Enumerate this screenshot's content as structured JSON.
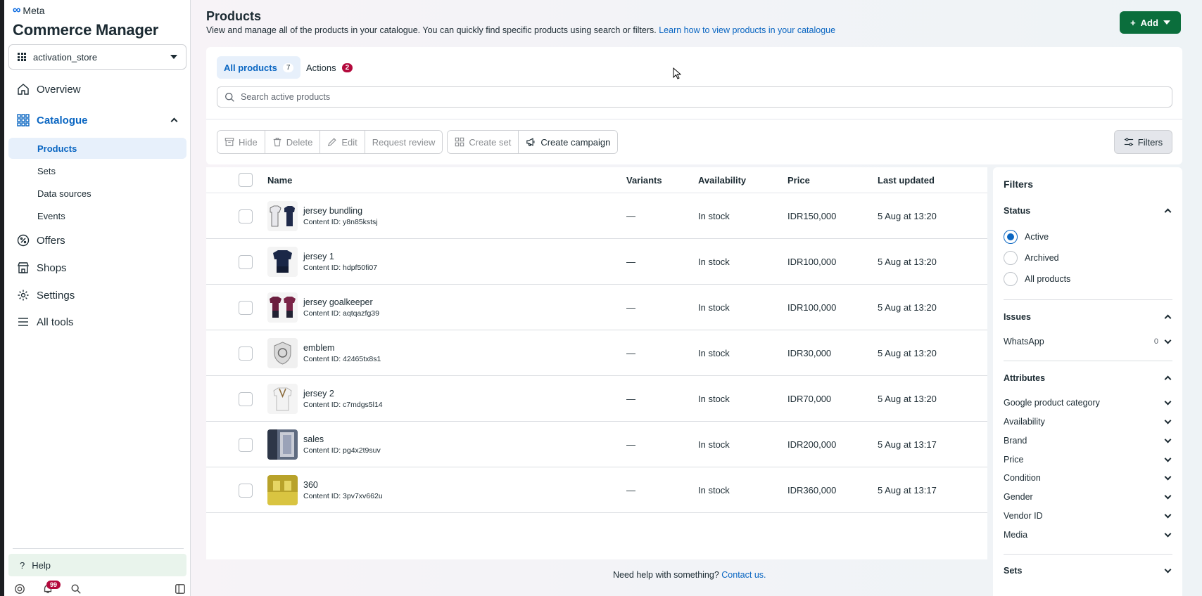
{
  "brand": {
    "meta_label": "Meta",
    "app_title": "Commerce Manager"
  },
  "store_select": {
    "value": "activation_store"
  },
  "sidebar": {
    "items": [
      {
        "label": "Overview",
        "icon": "home-icon"
      },
      {
        "label": "Catalogue",
        "icon": "grid-icon"
      },
      {
        "label": "Offers",
        "icon": "offers-icon"
      },
      {
        "label": "Shops",
        "icon": "shop-icon"
      },
      {
        "label": "Settings",
        "icon": "gear-icon"
      },
      {
        "label": "All tools",
        "icon": "menu-icon"
      }
    ],
    "catalogue_sub": [
      "Products",
      "Sets",
      "Data sources",
      "Events"
    ],
    "help_label": "Help",
    "notifications_count": "99"
  },
  "header": {
    "title": "Products",
    "description": "View and manage all of the products in your catalogue. You can quickly find specific products using search or filters.",
    "learn_link": "Learn how to view products in your catalogue",
    "add_label": "Add"
  },
  "tabs": {
    "all_label": "All products",
    "all_count": "7",
    "actions_label": "Actions",
    "actions_count": "2"
  },
  "search": {
    "placeholder": "Search active products"
  },
  "toolbar": {
    "hide": "Hide",
    "delete": "Delete",
    "edit": "Edit",
    "request_review": "Request review",
    "create_set": "Create set",
    "create_campaign": "Create campaign",
    "filters": "Filters"
  },
  "table": {
    "columns": [
      "Name",
      "Variants",
      "Availability",
      "Price",
      "Last updated"
    ],
    "rows": [
      {
        "name": "jersey bundling",
        "content_id": "Content ID: y8n85kstsj",
        "variants": "—",
        "availability": "In stock",
        "price": "IDR150,000",
        "updated": "5 Aug at 13:20"
      },
      {
        "name": "jersey 1",
        "content_id": "Content ID: hdpf50fi07",
        "variants": "—",
        "availability": "In stock",
        "price": "IDR100,000",
        "updated": "5 Aug at 13:20"
      },
      {
        "name": "jersey goalkeeper",
        "content_id": "Content ID: aqtqazfg39",
        "variants": "—",
        "availability": "In stock",
        "price": "IDR100,000",
        "updated": "5 Aug at 13:20"
      },
      {
        "name": "emblem",
        "content_id": "Content ID: 42465tx8s1",
        "variants": "—",
        "availability": "In stock",
        "price": "IDR30,000",
        "updated": "5 Aug at 13:20"
      },
      {
        "name": "jersey 2",
        "content_id": "Content ID: c7mdgs5l14",
        "variants": "—",
        "availability": "In stock",
        "price": "IDR70,000",
        "updated": "5 Aug at 13:20"
      },
      {
        "name": "sales",
        "content_id": "Content ID: pg4x2t9suv",
        "variants": "—",
        "availability": "In stock",
        "price": "IDR200,000",
        "updated": "5 Aug at 13:17"
      },
      {
        "name": "360",
        "content_id": "Content ID: 3pv7xv662u",
        "variants": "—",
        "availability": "In stock",
        "price": "IDR360,000",
        "updated": "5 Aug at 13:17"
      }
    ]
  },
  "footer": {
    "text": "Need help with something?",
    "link": "Contact us."
  },
  "filters_panel": {
    "title": "Filters",
    "status_label": "Status",
    "status_options": [
      "Active",
      "Archived",
      "All products"
    ],
    "issues_label": "Issues",
    "whatsapp_label": "WhatsApp",
    "whatsapp_count": "0",
    "attributes_label": "Attributes",
    "attributes": [
      "Google product category",
      "Availability",
      "Brand",
      "Price",
      "Condition",
      "Gender",
      "Vendor ID",
      "Media"
    ],
    "sets_label": "Sets"
  },
  "colors": {
    "accent": "#0a66c2",
    "add_button": "#0b6e3c",
    "badge": "#b3093c"
  }
}
